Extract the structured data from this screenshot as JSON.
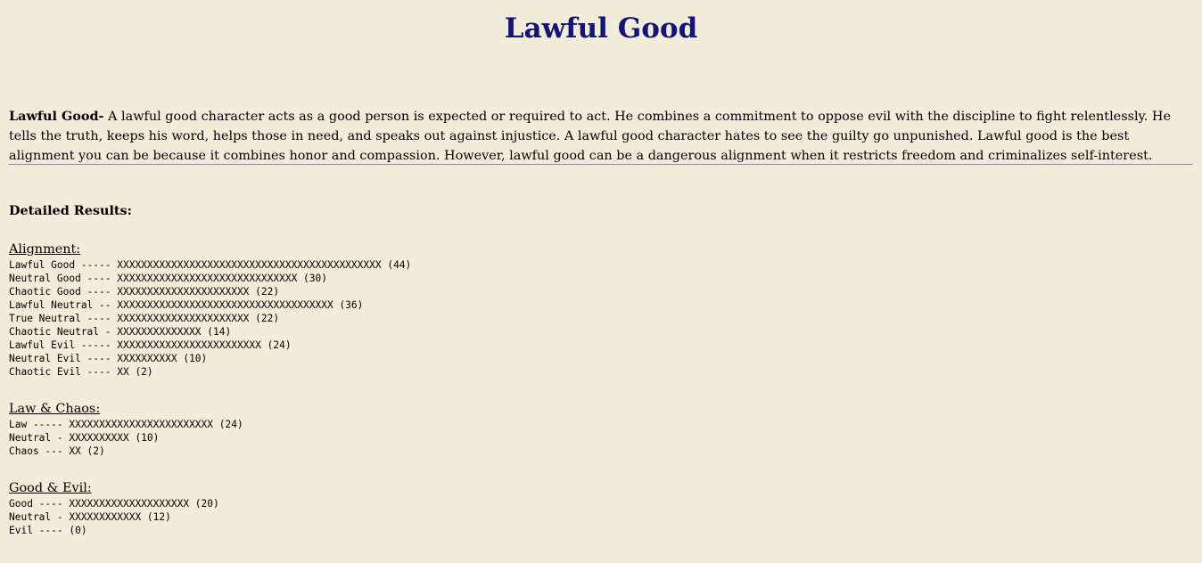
{
  "title": "Lawful Good",
  "description": {
    "label": "Lawful Good-",
    "text": " A lawful good character acts as a good person is expected or required to act. He combines a commitment to oppose evil with the discipline to fight relentlessly. He tells the truth, keeps his word, helps those in need, and speaks out against injustice. A lawful good character hates to see the guilty go unpunished. Lawful good is the best alignment you can be because it combines honor and compassion. However, lawful good can be a dangerous alignment when it restricts freedom and criminalizes self-interest."
  },
  "detailed_heading": "Detailed Results:",
  "sections": [
    {
      "heading": "Alignment:",
      "rows": [
        {
          "text": "Lawful Good ----- XXXXXXXXXXXXXXXXXXXXXXXXXXXXXXXXXXXXXXXXXXXX (44)"
        },
        {
          "text": "Neutral Good ---- XXXXXXXXXXXXXXXXXXXXXXXXXXXXXX (30)"
        },
        {
          "text": "Chaotic Good ---- XXXXXXXXXXXXXXXXXXXXXX (22)"
        },
        {
          "text": "Lawful Neutral -- XXXXXXXXXXXXXXXXXXXXXXXXXXXXXXXXXXXX (36)"
        },
        {
          "text": "True Neutral ---- XXXXXXXXXXXXXXXXXXXXXX (22)"
        },
        {
          "text": "Chaotic Neutral - XXXXXXXXXXXXXX (14)"
        },
        {
          "text": "Lawful Evil ----- XXXXXXXXXXXXXXXXXXXXXXXX (24)"
        },
        {
          "text": "Neutral Evil ---- XXXXXXXXXX (10)"
        },
        {
          "text": "Chaotic Evil ---- XX (2)"
        }
      ]
    },
    {
      "heading": "Law & Chaos:",
      "rows": [
        {
          "text": "Law ----- XXXXXXXXXXXXXXXXXXXXXXXX (24)"
        },
        {
          "text": "Neutral - XXXXXXXXXX (10)"
        },
        {
          "text": "Chaos --- XX (2)"
        }
      ]
    },
    {
      "heading": "Good & Evil:",
      "rows": [
        {
          "text": "Good ---- XXXXXXXXXXXXXXXXXXXX (20)"
        },
        {
          "text": "Neutral - XXXXXXXXXXXX (12)"
        },
        {
          "text": "Evil ---- (0)"
        }
      ]
    }
  ]
}
